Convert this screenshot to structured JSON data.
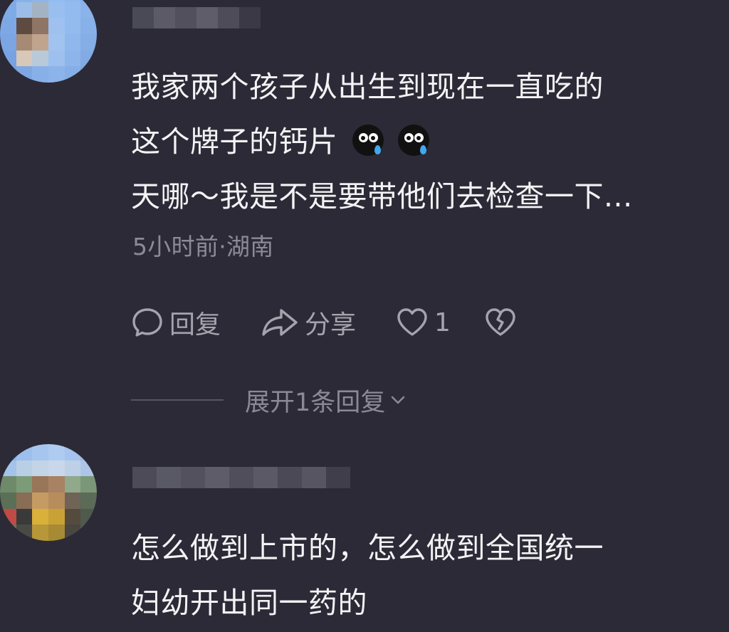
{
  "comments": [
    {
      "avatar_name": "avatar-blurred",
      "text_lines": [
        "我家两个孩子从出生到现在一直吃的",
        "这个牌子的钙片",
        "天哪～我是不是要带他们去检查一下..."
      ],
      "emojis": [
        "crying-emoji",
        "crying-emoji"
      ],
      "meta": "5小时前·湖南",
      "actions": {
        "reply": "回复",
        "share": "分享",
        "like_count": "1"
      },
      "expand_replies": "展开1条回复"
    },
    {
      "avatar_name": "avatar-blurred",
      "text_lines": [
        "怎么做到上市的，怎么做到全国统一",
        "妇幼开出同一药的"
      ]
    }
  ],
  "colors": {
    "background": "#2b2a36",
    "text": "#f3f3f5",
    "meta": "#8c8b95",
    "action": "#a5a4ad",
    "tear": "#41a8ee"
  }
}
